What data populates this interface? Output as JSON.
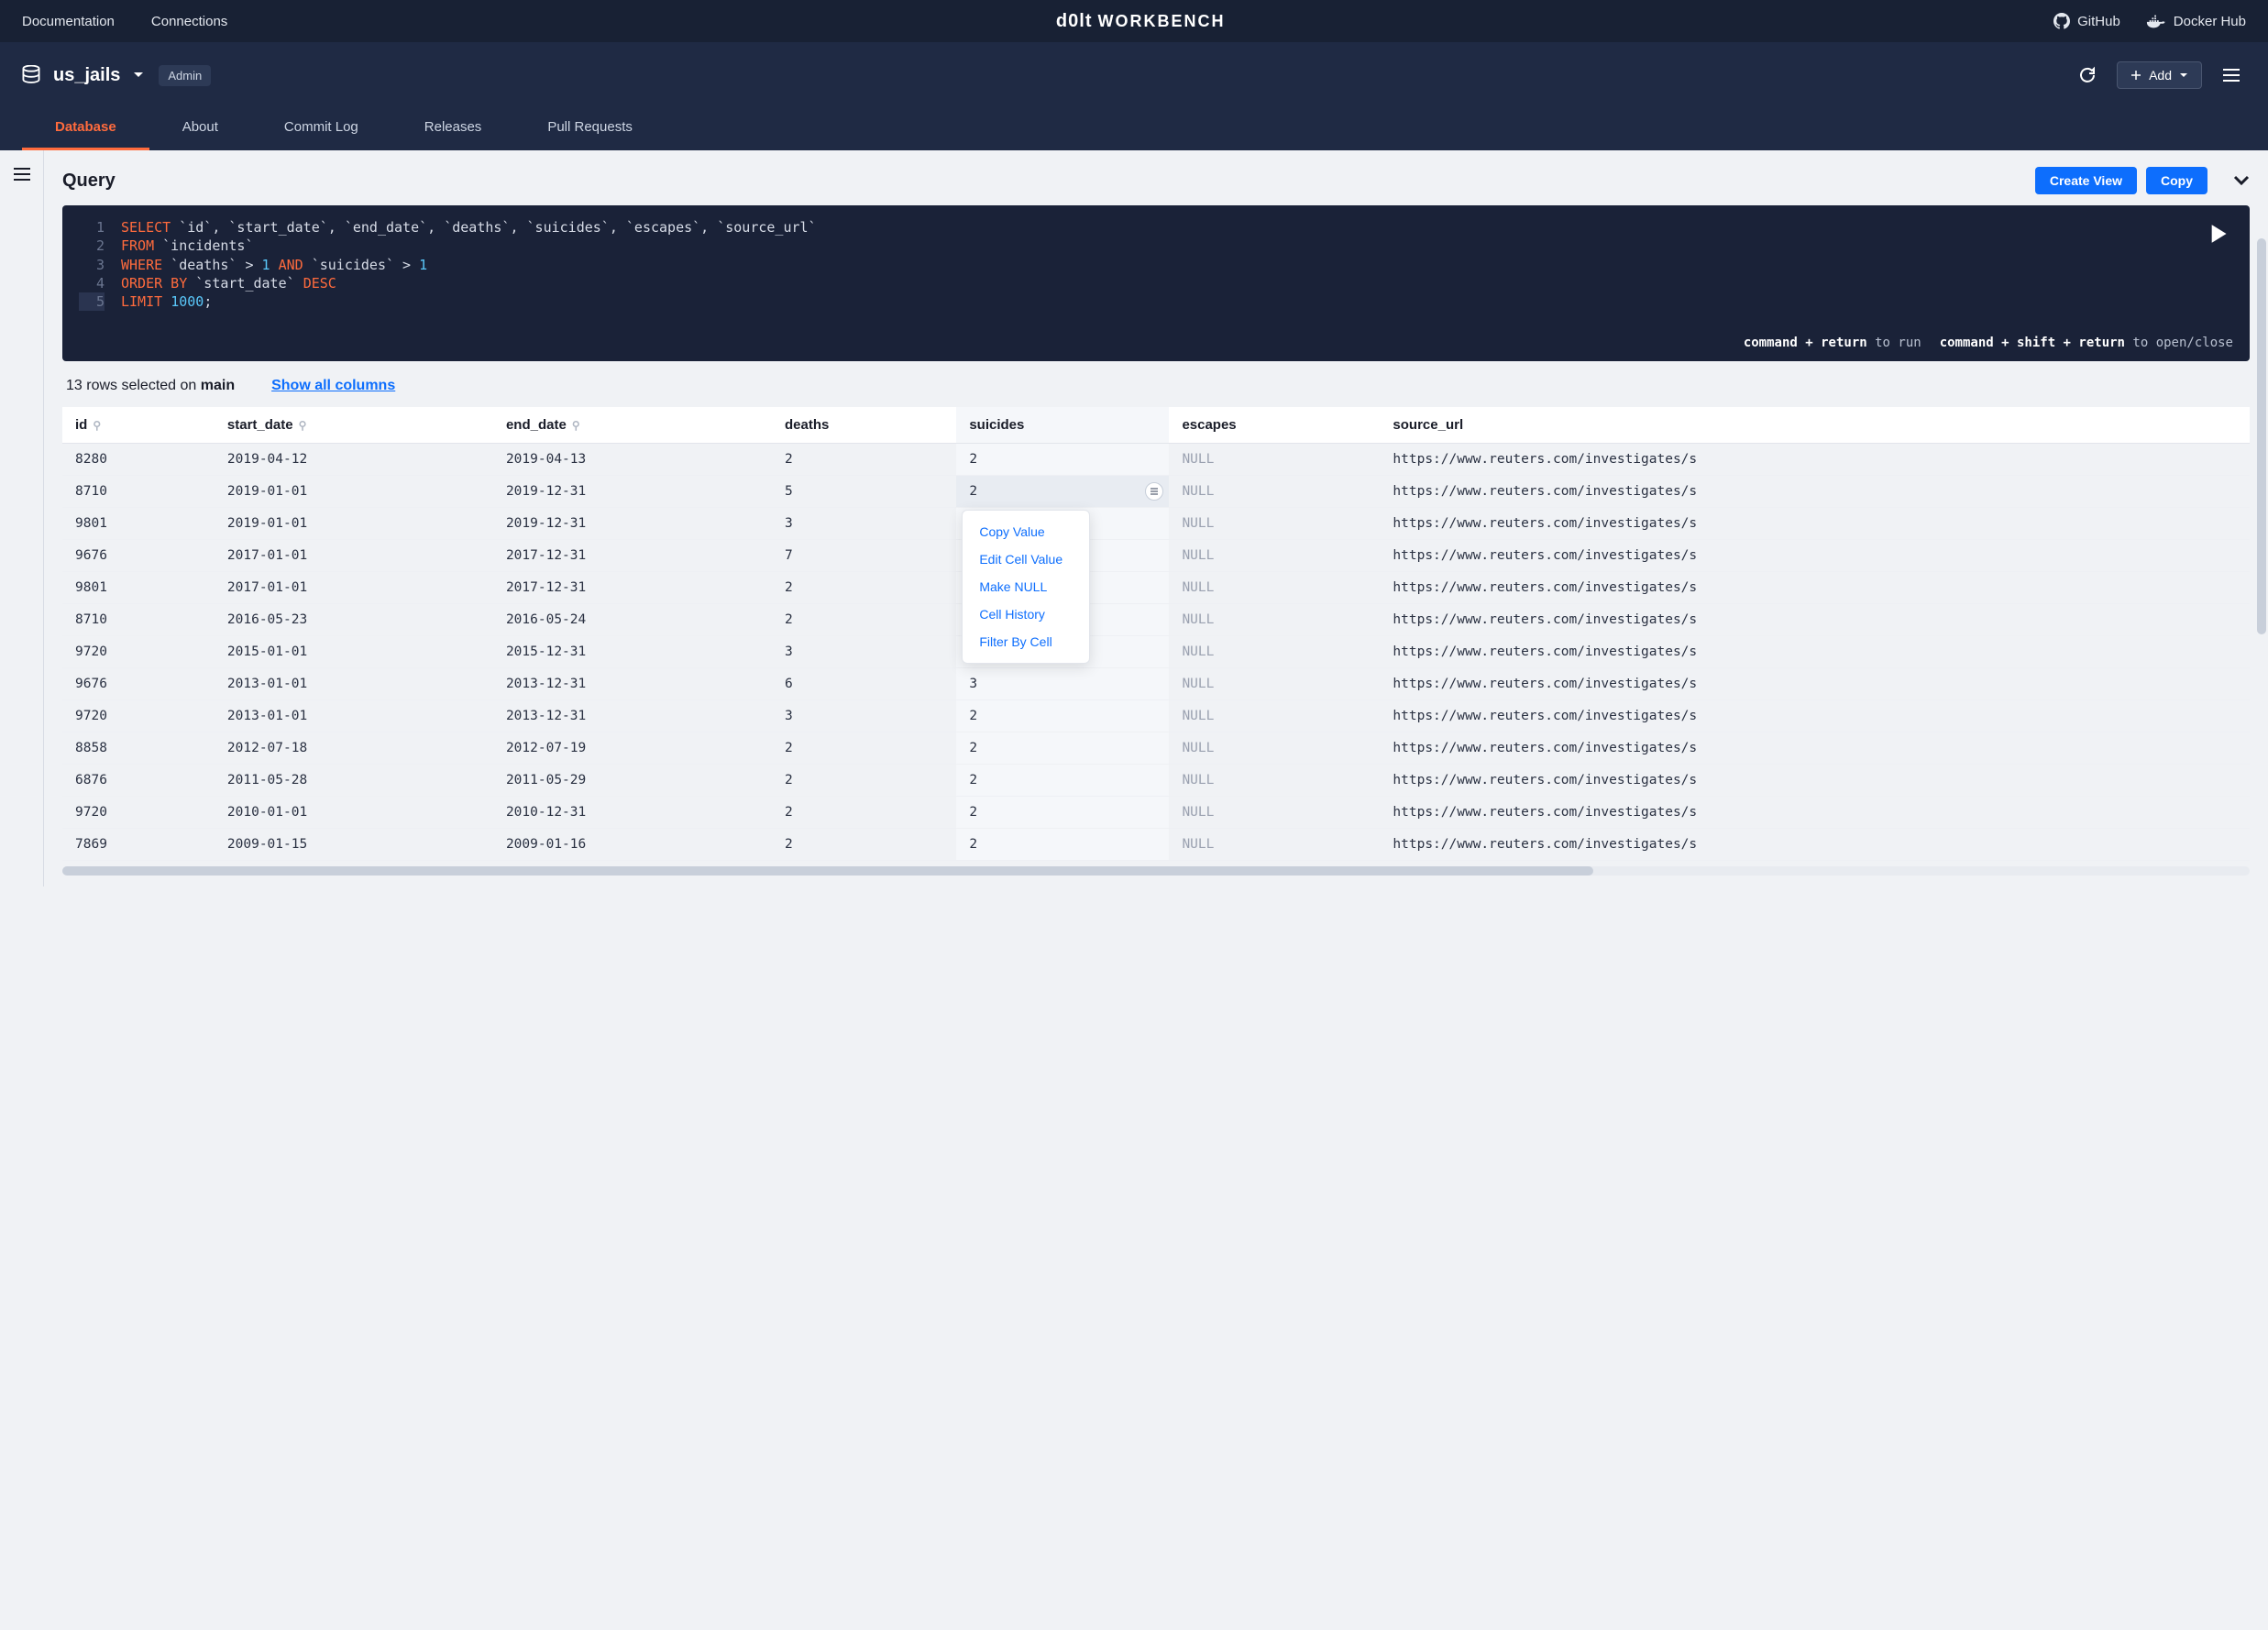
{
  "topbar": {
    "links_left": [
      "Documentation",
      "Connections"
    ],
    "logo_brand": "d0lt",
    "logo_sub": "WORKBENCH",
    "links_right": [
      {
        "icon": "github",
        "label": "GitHub"
      },
      {
        "icon": "docker",
        "label": "Docker Hub"
      }
    ]
  },
  "navbar": {
    "db_name": "us_jails",
    "badge": "Admin",
    "add_label": "Add",
    "tabs": [
      "Database",
      "About",
      "Commit Log",
      "Releases",
      "Pull Requests"
    ],
    "active_tab": 0
  },
  "query_panel": {
    "title": "Query",
    "create_view": "Create View",
    "copy": "Copy",
    "hint_run_prefix": "command + return",
    "hint_run_suffix": " to run",
    "hint_toggle_prefix": "command + shift + return",
    "hint_toggle_suffix": " to open/close"
  },
  "sql": {
    "lines": [
      {
        "n": "1",
        "tokens": [
          [
            "kw-orange",
            "SELECT"
          ],
          [
            "str",
            " `id`, `start_date`, `end_date`, `deaths`, `suicides`, `escapes`, `source_url`"
          ]
        ]
      },
      {
        "n": "2",
        "tokens": [
          [
            "kw-orange",
            "FROM"
          ],
          [
            "str",
            " `incidents`"
          ]
        ]
      },
      {
        "n": "3",
        "tokens": [
          [
            "kw-orange",
            "WHERE"
          ],
          [
            "str",
            " `deaths` > "
          ],
          [
            "kw-blue",
            "1"
          ],
          [
            "kw-orange",
            " AND"
          ],
          [
            "str",
            " `suicides` > "
          ],
          [
            "kw-blue",
            "1"
          ]
        ]
      },
      {
        "n": "4",
        "tokens": [
          [
            "kw-orange",
            "ORDER BY"
          ],
          [
            "str",
            " `start_date` "
          ],
          [
            "kw-orange",
            "DESC"
          ]
        ]
      },
      {
        "n": "5",
        "tokens": [
          [
            "kw-orange",
            "LIMIT"
          ],
          [
            "str",
            " "
          ],
          [
            "kw-blue",
            "1000"
          ],
          [
            "str",
            ";"
          ]
        ]
      }
    ],
    "active_line": 5
  },
  "results": {
    "summary_prefix": "13 rows selected on ",
    "summary_branch": "main",
    "show_all": "Show all columns",
    "columns": [
      {
        "name": "id",
        "key": true
      },
      {
        "name": "start_date",
        "key": true
      },
      {
        "name": "end_date",
        "key": true
      },
      {
        "name": "deaths",
        "key": false
      },
      {
        "name": "suicides",
        "key": false
      },
      {
        "name": "escapes",
        "key": false
      },
      {
        "name": "source_url",
        "key": false
      }
    ],
    "focus_col": 4,
    "focus_row": 1,
    "rows": [
      [
        "8280",
        "2019-04-12",
        "2019-04-13",
        "2",
        "2",
        "NULL",
        "https://www.reuters.com/investigates/s"
      ],
      [
        "8710",
        "2019-01-01",
        "2019-12-31",
        "5",
        "2",
        "NULL",
        "https://www.reuters.com/investigates/s"
      ],
      [
        "9801",
        "2019-01-01",
        "2019-12-31",
        "3",
        "",
        "NULL",
        "https://www.reuters.com/investigates/s"
      ],
      [
        "9676",
        "2017-01-01",
        "2017-12-31",
        "7",
        "",
        "NULL",
        "https://www.reuters.com/investigates/s"
      ],
      [
        "9801",
        "2017-01-01",
        "2017-12-31",
        "2",
        "",
        "NULL",
        "https://www.reuters.com/investigates/s"
      ],
      [
        "8710",
        "2016-05-23",
        "2016-05-24",
        "2",
        "",
        "NULL",
        "https://www.reuters.com/investigates/s"
      ],
      [
        "9720",
        "2015-01-01",
        "2015-12-31",
        "3",
        "",
        "NULL",
        "https://www.reuters.com/investigates/s"
      ],
      [
        "9676",
        "2013-01-01",
        "2013-12-31",
        "6",
        "3",
        "NULL",
        "https://www.reuters.com/investigates/s"
      ],
      [
        "9720",
        "2013-01-01",
        "2013-12-31",
        "3",
        "2",
        "NULL",
        "https://www.reuters.com/investigates/s"
      ],
      [
        "8858",
        "2012-07-18",
        "2012-07-19",
        "2",
        "2",
        "NULL",
        "https://www.reuters.com/investigates/s"
      ],
      [
        "6876",
        "2011-05-28",
        "2011-05-29",
        "2",
        "2",
        "NULL",
        "https://www.reuters.com/investigates/s"
      ],
      [
        "9720",
        "2010-01-01",
        "2010-12-31",
        "2",
        "2",
        "NULL",
        "https://www.reuters.com/investigates/s"
      ],
      [
        "7869",
        "2009-01-15",
        "2009-01-16",
        "2",
        "2",
        "NULL",
        "https://www.reuters.com/investigates/s"
      ]
    ]
  },
  "context_menu": {
    "items": [
      "Copy Value",
      "Edit Cell Value",
      "Make NULL",
      "Cell History",
      "Filter By Cell"
    ]
  }
}
